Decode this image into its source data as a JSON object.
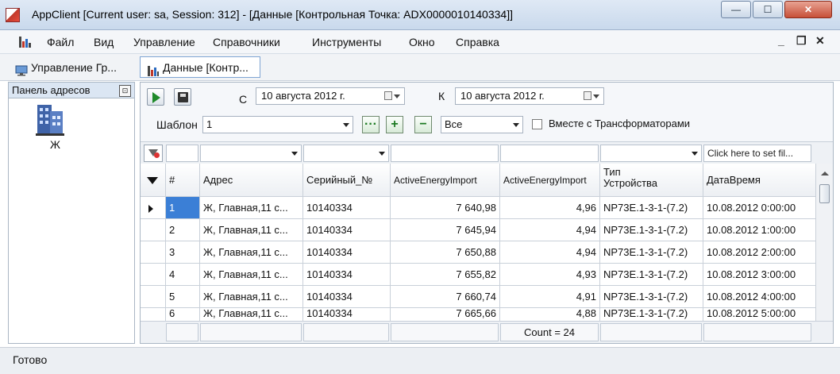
{
  "window": {
    "title": "AppClient  [Current user: sa, Session: 312] - [Данные [Контрольная Точка: ADX0000010140334]]",
    "min_glyph": "—",
    "max_glyph": "☐",
    "close_glyph": "✕"
  },
  "menu": {
    "items": [
      "Файл",
      "Вид",
      "Управление",
      "Справочники",
      "Инструменты",
      "Окно",
      "Справка"
    ],
    "mdi_min": "_",
    "mdi_restore": "❐",
    "mdi_close": "✕"
  },
  "tabs": [
    {
      "label": "Управление Гр...",
      "icon": "monitor-icon"
    },
    {
      "label": "Данные [Контр...",
      "icon": "bar-chart-icon"
    }
  ],
  "address_panel": {
    "title": "Панель адресов",
    "node_label": "Ж"
  },
  "toolbar": {
    "from_label": "С",
    "from_date": "10  августа  2012 г.",
    "to_label": "К",
    "to_date": "10  августа  2012 г.",
    "template_label": "Шаблон",
    "template_value": "1",
    "more_label": "···",
    "add_label": "+",
    "remove_label": "−",
    "filter_value": "Все",
    "transformers_label": "Вместе с Трансформаторами"
  },
  "filter_row": {
    "placeholder": "Click here to set fil..."
  },
  "grid": {
    "columns": [
      "#",
      "Адрес",
      "Серийный_№",
      "ActiveEnergyImport",
      "ActiveEnergyImport",
      "Тип Устройства",
      "ДатаВремя"
    ],
    "column_type_line1": "Тип",
    "column_type_line2": "Устройства",
    "rows": [
      [
        "1",
        "Ж, Главная,11 с...",
        "10140334",
        "7 640,98",
        "4,96",
        "NP73E.1-3-1-(7.2)",
        "10.08.2012 0:00:00"
      ],
      [
        "2",
        "Ж, Главная,11 с...",
        "10140334",
        "7 645,94",
        "4,94",
        "NP73E.1-3-1-(7.2)",
        "10.08.2012 1:00:00"
      ],
      [
        "3",
        "Ж, Главная,11 с...",
        "10140334",
        "7 650,88",
        "4,94",
        "NP73E.1-3-1-(7.2)",
        "10.08.2012 2:00:00"
      ],
      [
        "4",
        "Ж, Главная,11 с...",
        "10140334",
        "7 655,82",
        "4,93",
        "NP73E.1-3-1-(7.2)",
        "10.08.2012 3:00:00"
      ],
      [
        "5",
        "Ж, Главная,11 с...",
        "10140334",
        "7 660,74",
        "4,91",
        "NP73E.1-3-1-(7.2)",
        "10.08.2012 4:00:00"
      ],
      [
        "6",
        "Ж, Главная,11 с...",
        "10140334",
        "7 665,66",
        "4,88",
        "NP73E.1-3-1-(7.2)",
        "10.08.2012 5:00:00"
      ]
    ],
    "footer_count": "Count = 24"
  },
  "status": {
    "text": "Готово"
  },
  "colors": {
    "selection": "#3b7fd6",
    "play": "#1f8a2a"
  }
}
